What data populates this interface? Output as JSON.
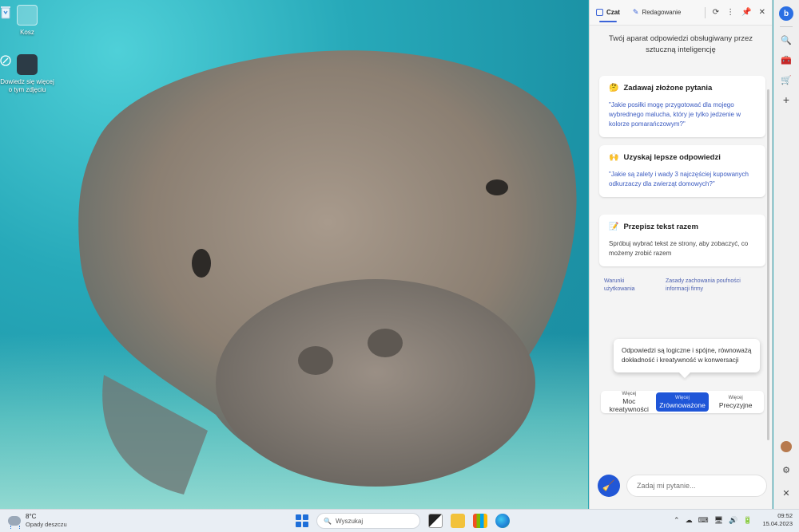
{
  "desktop": {
    "icons": [
      {
        "label": "Kosz",
        "icon": "recycle-bin-icon"
      },
      {
        "label": "Dowiedz się więcej o tym zdjęciu",
        "icon": "learn-more-icon"
      }
    ]
  },
  "panel": {
    "tabs": [
      {
        "label": "Czat",
        "active": true
      },
      {
        "label": "Redagowanie",
        "active": false
      }
    ],
    "header_actions": [
      "refresh-icon",
      "more-icon",
      "pin-icon",
      "close-icon"
    ],
    "intro": "Twój aparat odpowiedzi obsługiwany przez sztuczną inteligencję",
    "cards": [
      {
        "emoji": "🤔",
        "title": "Zadawaj złożone pytania",
        "text": "\"Jakie posiłki mogę przygotować dla mojego wybrednego malucha, który je tylko jedzenie w kolorze pomarańczowym?\""
      },
      {
        "emoji": "🙌",
        "title": "Uzyskaj lepsze odpowiedzi",
        "text": "\"Jakie są zalety i wady 3 najczęściej kupowanych odkurzaczy dla zwierząt domowych?\""
      },
      {
        "emoji": "📝",
        "title": "Przepisz tekst razem",
        "text": "Spróbuj wybrać tekst ze strony, aby zobaczyć, co możemy zrobić razem"
      }
    ],
    "links": {
      "terms": "Warunki użytkowania",
      "privacy": "Zasady zachowania poufności informacji firmy"
    },
    "tooltip": "Odpowiedzi są logiczne i spójne, równoważą dokładność i kreatywność w konwersacji",
    "tones": [
      {
        "small": "Więcej",
        "big": "Moc kreatywności",
        "active": false
      },
      {
        "small": "Więcej",
        "big": "Zrównoważone",
        "active": true
      },
      {
        "small": "Więcej",
        "big": "Precyzyjne",
        "active": false
      }
    ],
    "input_placeholder": "Zadaj mi pytanie...",
    "accent": "#1f56d8"
  },
  "taskbar": {
    "weather": {
      "temp": "8°C",
      "desc": "Opady deszczu"
    },
    "search_placeholder": "Wyszukaj",
    "clock": {
      "time": "09:52",
      "date": "15.04.2023"
    }
  }
}
